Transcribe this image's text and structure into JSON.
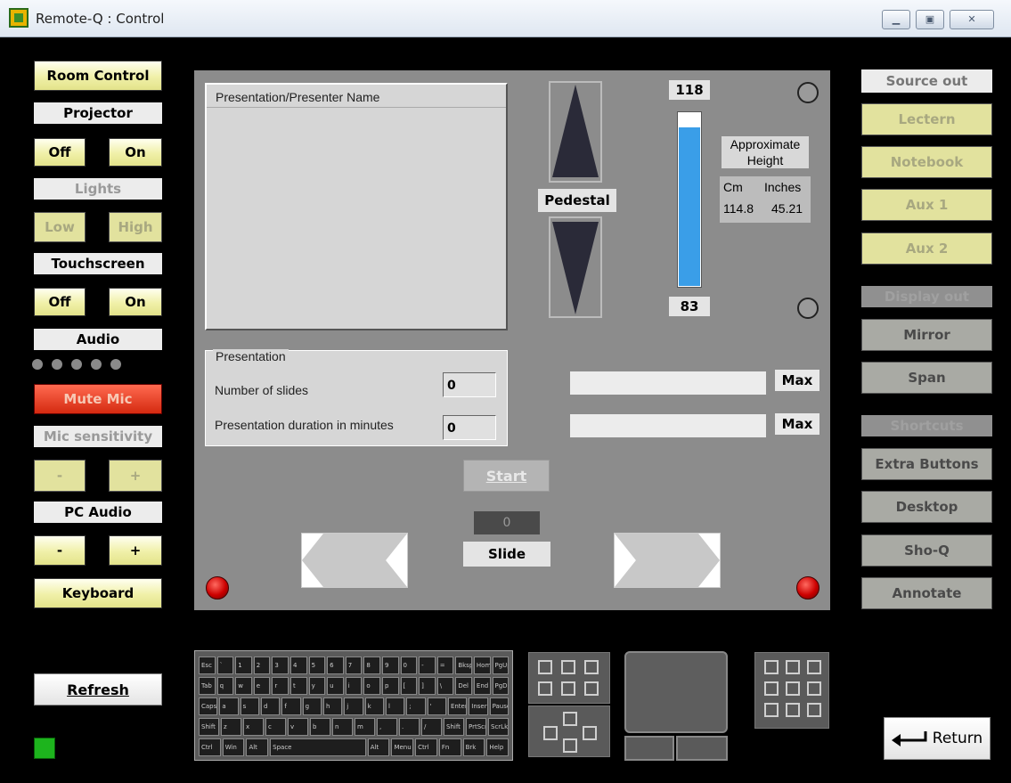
{
  "window": {
    "title": "Remote-Q : Control"
  },
  "left": {
    "room_control": "Room Control",
    "projector": {
      "label": "Projector",
      "off": "Off",
      "on": "On"
    },
    "lights": {
      "label": "Lights",
      "low": "Low",
      "high": "High"
    },
    "touchscreen": {
      "label": "Touchscreen",
      "off": "Off",
      "on": "On"
    },
    "audio": {
      "label": "Audio",
      "level_dots": 5
    },
    "mute_mic": "Mute Mic",
    "mic_sensitivity": {
      "label": "Mic sensitivity",
      "minus": "-",
      "plus": "+"
    },
    "pc_audio": {
      "label": "PC Audio",
      "minus": "-",
      "plus": "+"
    },
    "keyboard": "Keyboard",
    "refresh": "Refresh"
  },
  "center": {
    "presenter_list_header": "Presentation/Presenter Name",
    "presentation": {
      "title": "Presentation",
      "slides_label": "Number of slides",
      "slides_value": "0",
      "duration_label": "Presentation duration in minutes",
      "duration_value": "0"
    },
    "pedestal": {
      "label": "Pedestal",
      "max": "118",
      "min": "83",
      "level_fraction": 0.91,
      "approx_height": "Approximate Height",
      "cm_label": "Cm",
      "inches_label": "Inches",
      "cm_value": "114.8",
      "inches_value": "45.21"
    },
    "bars": {
      "max1": "Max",
      "max2": "Max"
    },
    "start": "Start",
    "slide_counter": "0",
    "slide_label": "Slide"
  },
  "right": {
    "source_out": "Source out",
    "lectern": "Lectern",
    "notebook": "Notebook",
    "aux1": "Aux 1",
    "aux2": "Aux 2",
    "display_out": "Display out",
    "mirror": "Mirror",
    "span": "Span",
    "shortcuts": "Shortcuts",
    "extra_buttons": "Extra Buttons",
    "desktop": "Desktop",
    "sho_q": "Sho-Q",
    "annotate": "Annotate",
    "return": "Return"
  },
  "keyboard_rows": [
    [
      "Esc",
      "`",
      "1",
      "2",
      "3",
      "4",
      "5",
      "6",
      "7",
      "8",
      "9",
      "0",
      "-",
      "=",
      "Bksp",
      "Home",
      "PgUp"
    ],
    [
      "Tab",
      "q",
      "w",
      "e",
      "r",
      "t",
      "y",
      "u",
      "i",
      "o",
      "p",
      "[",
      "]",
      "\\",
      "Del",
      "End",
      "PgDn"
    ],
    [
      "Caps",
      "a",
      "s",
      "d",
      "f",
      "g",
      "h",
      "j",
      "k",
      "l",
      ";",
      "'",
      "Enter",
      "Insert",
      "Pause"
    ],
    [
      "Shift",
      "z",
      "x",
      "c",
      "v",
      "b",
      "n",
      "m",
      ",",
      ".",
      "/",
      "Shift",
      "PrtScn",
      "ScrLk"
    ],
    [
      "Ctrl",
      "Win",
      "Alt",
      "Space",
      "Alt",
      "Menu",
      "Ctrl",
      "Fn",
      "Brk",
      "Help"
    ]
  ],
  "colors": {
    "accent_yellow": "#f0f0a8",
    "mute_red": "#e0401c",
    "slider_blue": "#3a9ee8",
    "status_green": "#1db41d"
  }
}
